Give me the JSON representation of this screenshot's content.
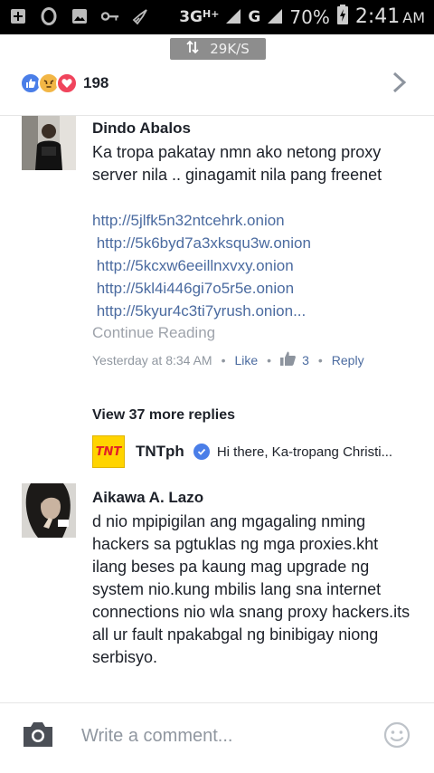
{
  "status_bar": {
    "net1": "3G",
    "net1_sup": "H+",
    "net1_sub": "1",
    "net2": "G",
    "net2_sub": "2",
    "battery": "70%",
    "time": "2:41",
    "ampm": "AM"
  },
  "speed_badge": {
    "value": "29K/S",
    "icon": "arrows-up-down-icon"
  },
  "reactions": {
    "icons": [
      "like-icon",
      "angry-icon",
      "love-icon"
    ],
    "count": "198"
  },
  "comments": [
    {
      "author": "Dindo Abalos",
      "text": "Ka tropa pakatay nmn ako netong proxy server nila .. ginagamit nila pang freenet",
      "links": [
        "http://5jlfk5n32ntcehrk.onion",
        " http://5k6byd7a3xksqu3w.onion",
        " http://5kcxw6eeillnxvxy.onion",
        " http://5kl4i446gi7o5r5e.onion",
        " http://5kyur4c3ti7yrush.onion..."
      ],
      "continue_label": "Continue Reading",
      "time": "Yesterday at 8:34 AM",
      "like_label": "Like",
      "like_count": "3",
      "reply_label": "Reply"
    },
    {
      "author": "Aikawa A. Lazo",
      "text": "d nio mpipigilan ang mgagaling nming hackers sa pgtuklas ng mga proxies.kht ilang beses pa kaung mag upgrade ng system nio.kung mbilis lang sna internet connections nio wla snang proxy hackers.its all ur fault npakabgal ng binibigay niong serbisyo."
    }
  ],
  "more_replies_label": "View 37 more replies",
  "reply_preview": {
    "logo_text": "TNT",
    "author": "TNTph",
    "snippet": "Hi there, Ka-tropang Christi..."
  },
  "composer": {
    "placeholder": "Write a comment..."
  },
  "colors": {
    "link": "#4b6ba0",
    "like_blue": "#4a7ee8",
    "angry": "#f2b646",
    "love": "#f0445c",
    "tnt_yellow": "#ffd400"
  }
}
